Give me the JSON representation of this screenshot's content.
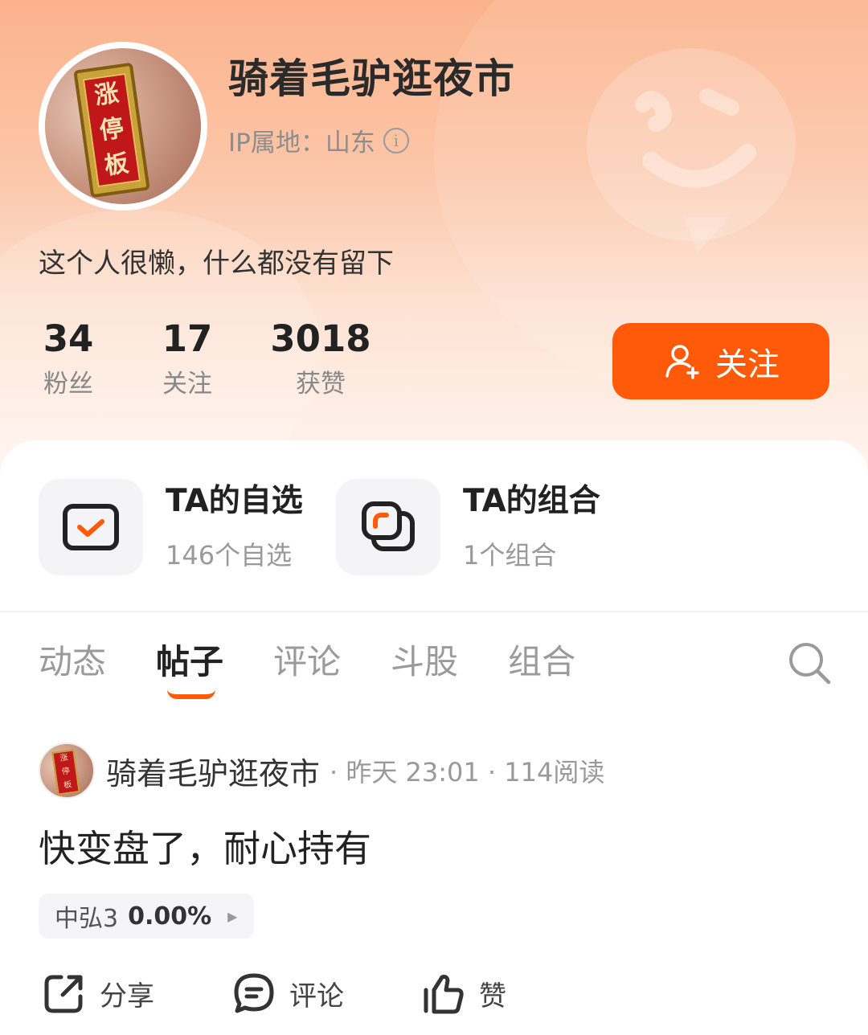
{
  "profile": {
    "username": "骑着毛驴逛夜市",
    "ip_location": "IP属地：山东",
    "bio": "这个人很懒，什么都没有留下",
    "avatar_text": [
      "涨",
      "停",
      "板"
    ]
  },
  "stats": [
    {
      "value": "34",
      "label": "粉丝"
    },
    {
      "value": "17",
      "label": "关注"
    },
    {
      "value": "3018",
      "label": "获赞"
    }
  ],
  "follow_button": {
    "label": "关注"
  },
  "features": [
    {
      "title": "TA的自选",
      "subtitle": "146个自选",
      "icon": "checkbox-icon"
    },
    {
      "title": "TA的组合",
      "subtitle": "1个组合",
      "icon": "portfolio-icon"
    }
  ],
  "tabs": [
    {
      "label": "动态",
      "active": false
    },
    {
      "label": "帖子",
      "active": true
    },
    {
      "label": "评论",
      "active": false
    },
    {
      "label": "斗股",
      "active": false
    },
    {
      "label": "组合",
      "active": false
    }
  ],
  "post": {
    "author": "骑着毛驴逛夜市",
    "meta": "· 昨天 23:01 · 114阅读",
    "body": "快变盘了，耐心持有",
    "stock": {
      "name": "中弘3",
      "change": "0.00%"
    },
    "actions": [
      {
        "label": "分享",
        "icon": "share-icon"
      },
      {
        "label": "评论",
        "icon": "comment-icon"
      },
      {
        "label": "赞",
        "icon": "thumbs-up-icon"
      }
    ]
  },
  "colors": {
    "accent": "#ff5a0a",
    "header_gradient_top": "#fbb28c",
    "text_primary": "#222222",
    "text_secondary": "#999999"
  }
}
